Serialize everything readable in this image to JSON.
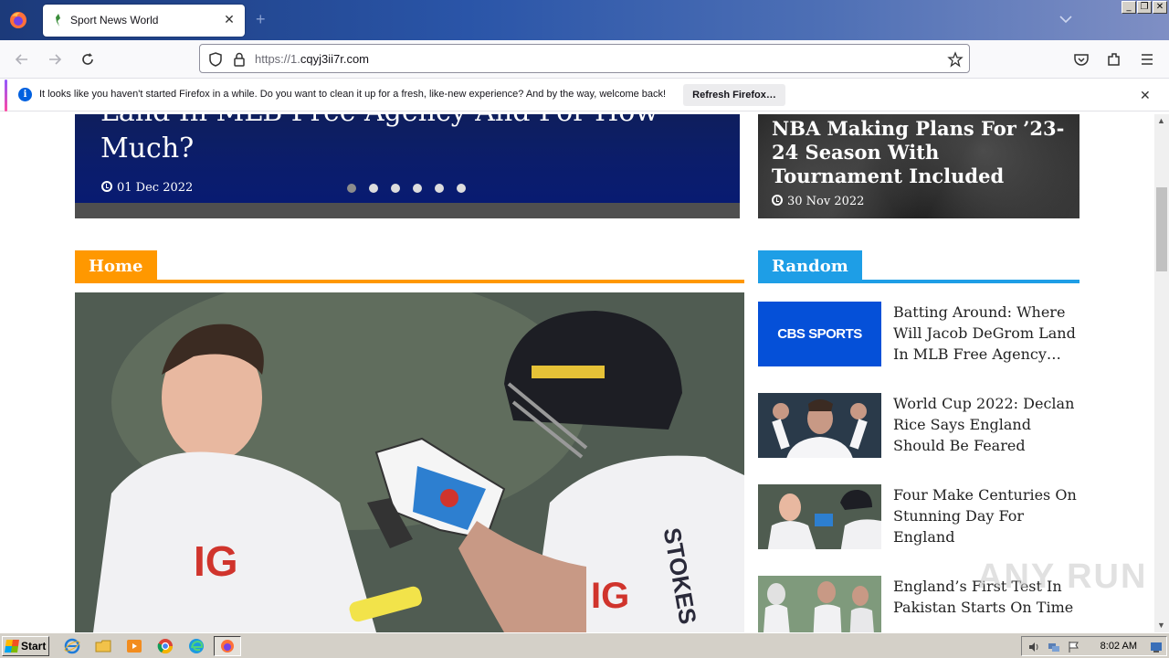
{
  "browser": {
    "tab_title": "Sport News World",
    "url_prefix": "https://1.",
    "url_domain": "cqyj3ii7r.com",
    "window_buttons": [
      "_",
      "❐",
      "✕"
    ]
  },
  "notification": {
    "message": "It looks like you haven't started Firefox in a while. Do you want to clean it up for a fresh, like-new experience? And by the way, welcome back!",
    "button_label": "Refresh Firefox…"
  },
  "hero": {
    "title": "Land In MLB Free Agency And For How Much?",
    "date": "01 Dec 2022",
    "slides": 6,
    "active_slide": 1
  },
  "side_hero": {
    "title": "NBA Making Plans For ’23-24 Season With Tournament Included",
    "date": "30 Nov 2022"
  },
  "sections": {
    "home_label": "Home",
    "random_label": "Random"
  },
  "random_items": [
    {
      "title": "Batting Around: Where Will Jacob DeGrom Land In MLB Free Agency An…",
      "thumb": "CBS SPORTS"
    },
    {
      "title": "World Cup 2022: Declan Rice Says England Should Be Feared",
      "thumb": ""
    },
    {
      "title": "Four Make Centuries On Stunning Day For England",
      "thumb": ""
    },
    {
      "title": "England’s First Test In Pakistan Starts On Time",
      "thumb": ""
    }
  ],
  "watermark": "ANY RUN",
  "taskbar": {
    "start_label": "Start",
    "time": "8:02 AM"
  },
  "colors": {
    "home_accent": "#ff9800",
    "random_accent": "#1e9ee6",
    "cbs_blue": "#0550d8"
  }
}
